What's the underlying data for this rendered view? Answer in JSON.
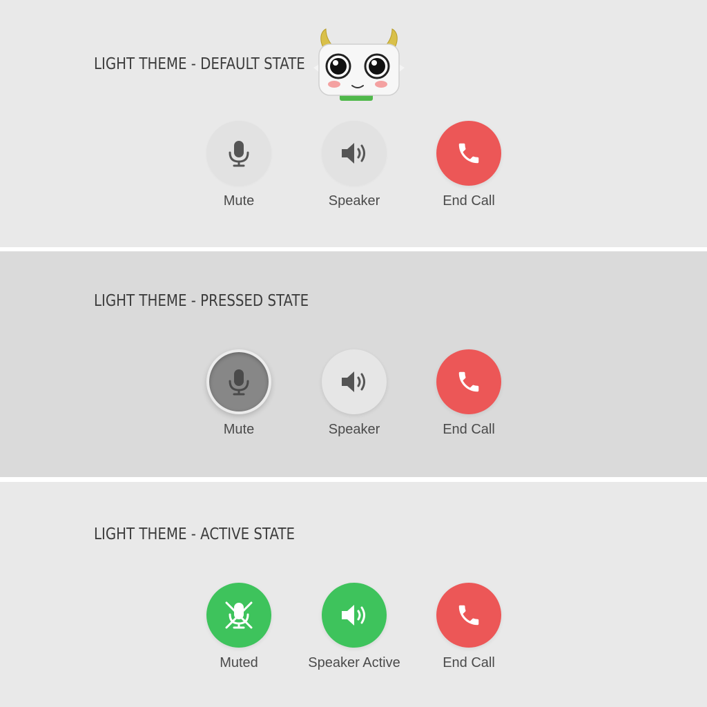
{
  "colors": {
    "end_call_red": "#ec5757",
    "active_green": "#3ec35c",
    "pressed_gray": "#878787",
    "neutral_button": "#e2e2e2",
    "icon_gray": "#555555"
  },
  "mascot": {
    "icon": "horned-robot-mascot"
  },
  "panels": [
    {
      "title": "LIGHT THEME - DEFAULT STATE",
      "buttons": [
        {
          "label": "Mute",
          "icon": "microphone-icon",
          "state": "default"
        },
        {
          "label": "Speaker",
          "icon": "speaker-icon",
          "state": "default"
        },
        {
          "label": "End Call",
          "icon": "phone-icon",
          "state": "danger"
        }
      ]
    },
    {
      "title": "LIGHT THEME - PRESSED STATE",
      "buttons": [
        {
          "label": "Mute",
          "icon": "microphone-icon",
          "state": "pressed"
        },
        {
          "label": "Speaker",
          "icon": "speaker-icon",
          "state": "default"
        },
        {
          "label": "End Call",
          "icon": "phone-icon",
          "state": "danger"
        }
      ]
    },
    {
      "title": "LIGHT THEME - ACTIVE STATE",
      "buttons": [
        {
          "label": "Muted",
          "icon": "microphone-muted-icon",
          "state": "active"
        },
        {
          "label": "Speaker Active",
          "icon": "speaker-icon",
          "state": "active"
        },
        {
          "label": "End Call",
          "icon": "phone-icon",
          "state": "danger"
        }
      ]
    }
  ]
}
